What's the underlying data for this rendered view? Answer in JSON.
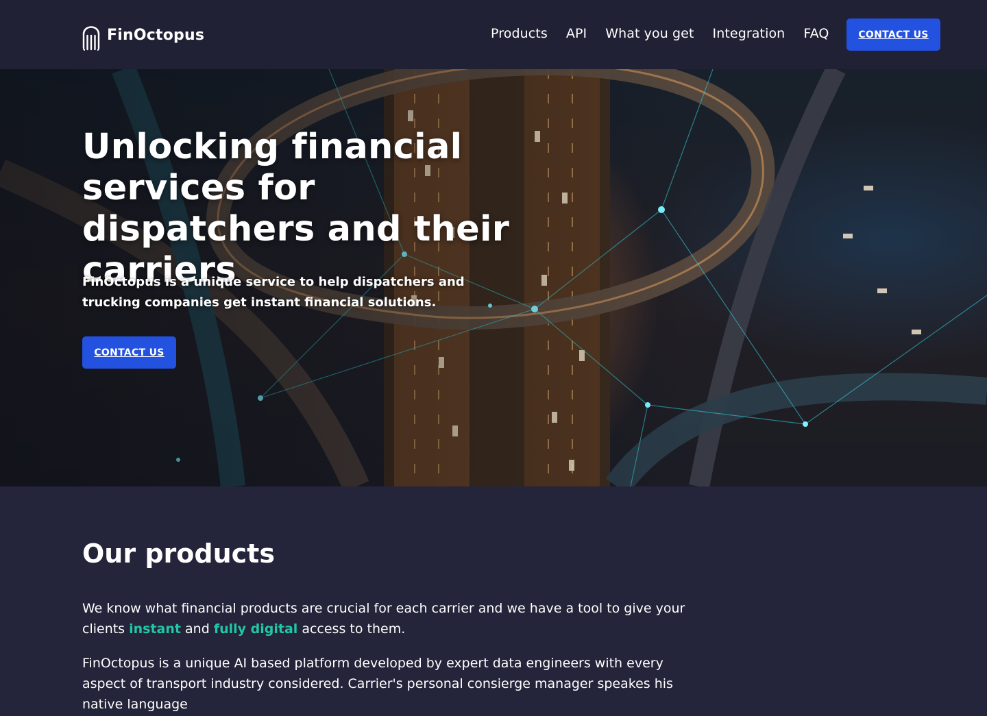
{
  "brand": {
    "name": "FinOctopus",
    "logo_icon": "octopus-icon"
  },
  "nav": {
    "items": [
      {
        "label": "Products"
      },
      {
        "label": "API"
      },
      {
        "label": "What you get"
      },
      {
        "label": "Integration"
      },
      {
        "label": "FAQ"
      }
    ],
    "cta_label": "CONTACT US"
  },
  "hero": {
    "title": "Unlocking financial services for dispatchers and their carriers",
    "subtitle": "FinOctopus is a unique service to help dispatchers and trucking companies get instant financial solutions.",
    "cta_label": "CONTACT US",
    "background": "aerial highway interchange at night with glowing network lines"
  },
  "products": {
    "title": "Our products",
    "p1_before": "We know what financial products are crucial for each carrier and we have a tool to give your clients ",
    "p1_highlight1": "instant",
    "p1_and": " and ",
    "p1_highlight2": "fully digital",
    "p1_after": " access to them.",
    "p2": "FinOctopus is a unique AI based platform developed by expert data engineers with every aspect of transport industry considered. Carrier's personal consierge manager speakes his native language"
  },
  "colors": {
    "page_bg": "#24243a",
    "header_bg": "#212135",
    "accent_blue": "#2351e0",
    "highlight_teal": "#21c7a8",
    "text": "#ffffff"
  }
}
